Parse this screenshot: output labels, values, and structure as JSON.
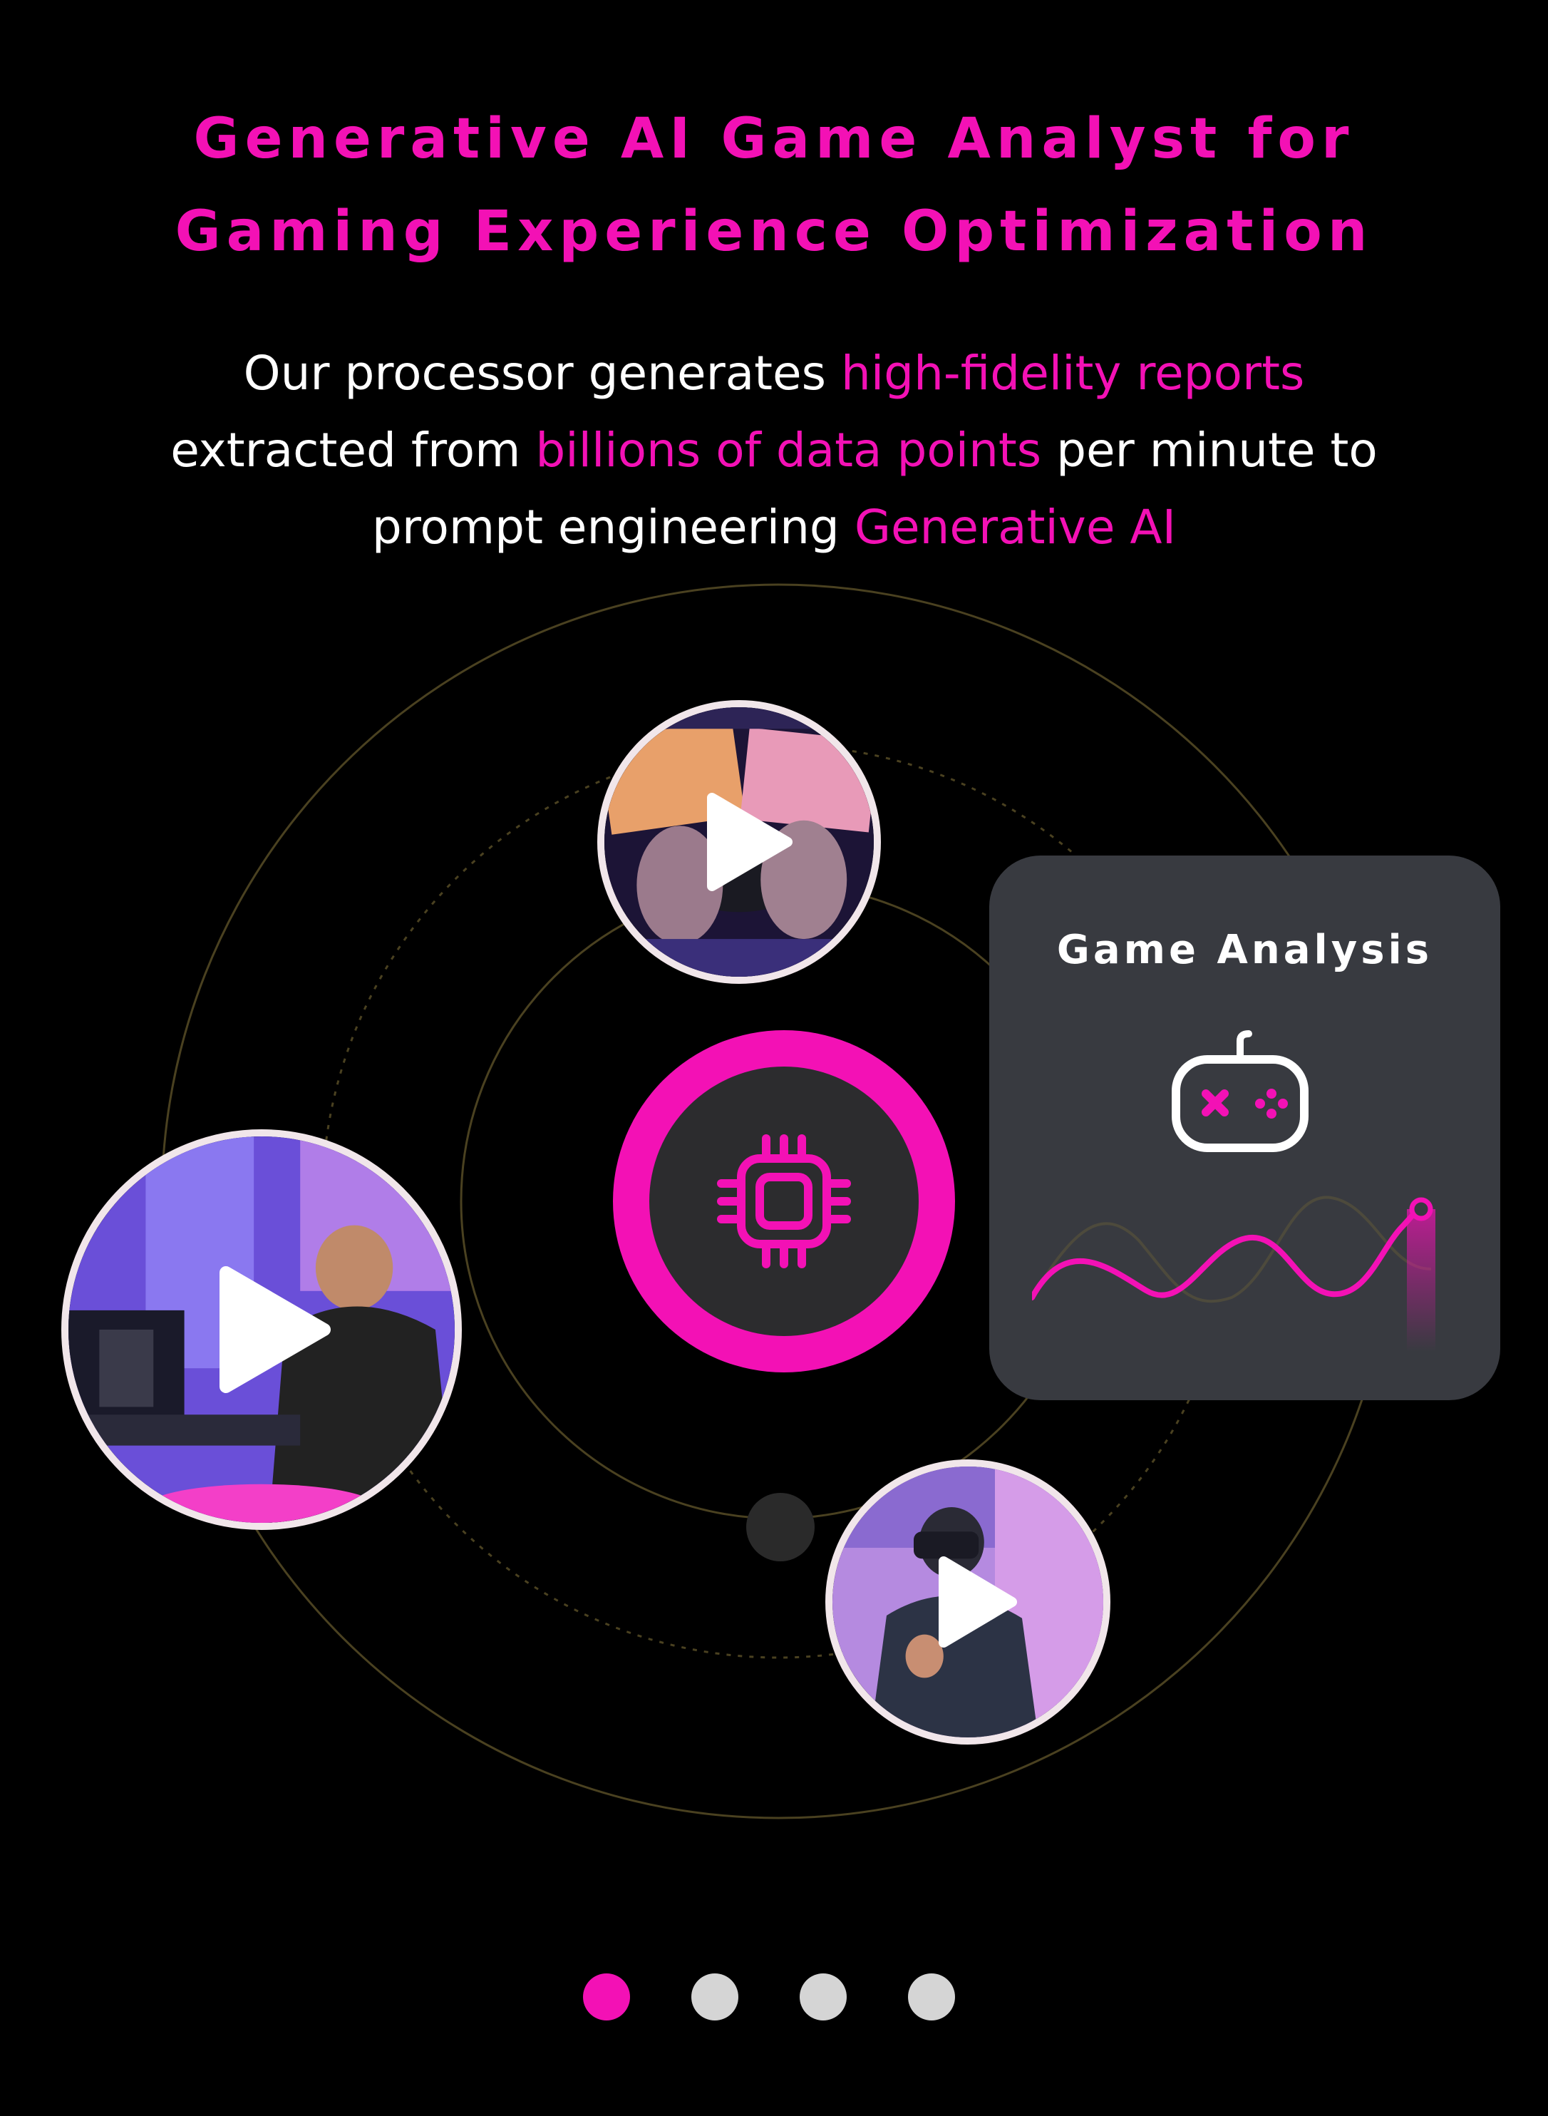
{
  "heading": {
    "line1": "Generative AI Game Analyst for",
    "line2": "Gaming Experience Optimization"
  },
  "subtitle": {
    "line1_a": "Our processor generates ",
    "line1_b": "high-fidelity reports",
    "line2_a": "extracted from ",
    "line2_b": "billions of data points",
    "line2_c": " per minute to",
    "line3_a": "prompt engineering ",
    "line3_b": "Generative AI"
  },
  "colors": {
    "accent": "#f311b5",
    "background": "#000000",
    "card": "#383a40",
    "orbit": "#4a4120"
  },
  "center": {
    "icon": "cpu-chip-icon"
  },
  "videos": [
    {
      "name": "keyboard-gamepad-video",
      "icon": "play-icon"
    },
    {
      "name": "gamer-desk-video",
      "icon": "play-icon"
    },
    {
      "name": "vr-player-video",
      "icon": "play-icon"
    }
  ],
  "card": {
    "title": "Game Analysis",
    "icon": "gamepad-icon"
  },
  "pagination": {
    "count": 4,
    "active_index": 0
  }
}
